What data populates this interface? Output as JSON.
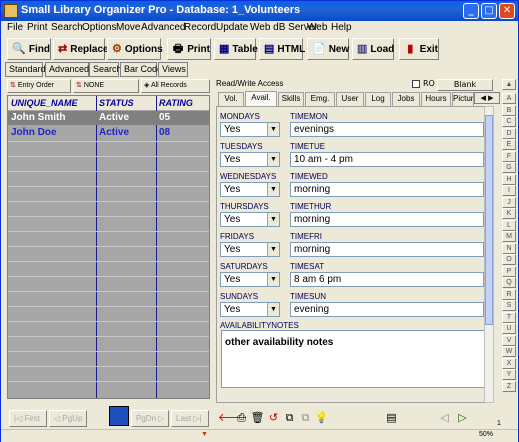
{
  "window": {
    "title": "Small Library Organizer Pro - Database: 1_Volunteers",
    "controls": [
      "_",
      "□",
      "✕"
    ]
  },
  "menu": [
    "File",
    "Print",
    "Search",
    "Options",
    "Move",
    "Advanced",
    "Record",
    "Update",
    "Web dB Server",
    "Web",
    "Help"
  ],
  "toolbar": [
    {
      "label": "Find",
      "icon": "find-icon"
    },
    {
      "label": "Replace",
      "icon": "replace-icon"
    },
    {
      "label": "Options",
      "icon": "options-icon"
    },
    {
      "label": "Print",
      "icon": "printer-icon"
    },
    {
      "label": "Table",
      "icon": "table-icon"
    },
    {
      "label": "HTML",
      "icon": "html-icon"
    },
    {
      "label": "New",
      "icon": "new-icon"
    },
    {
      "label": "Load",
      "icon": "load-icon"
    },
    {
      "label": "Exit",
      "icon": "exit-icon"
    }
  ],
  "view_tabs": [
    "Standard",
    "Advanced",
    "Search",
    "Bar Code",
    "Views"
  ],
  "sort_buttons": [
    "Entry Order",
    "NONE",
    "All Records"
  ],
  "grid": {
    "columns": [
      "UNIQUE_NAME",
      "STATUS",
      "RATING"
    ],
    "rows": [
      {
        "name": "John Smith",
        "status": "Active",
        "rating": "05",
        "selected": true
      },
      {
        "name": "John Doe",
        "status": "Active",
        "rating": "08",
        "selected": false
      }
    ]
  },
  "nav_buttons": [
    "|◁ First",
    "◁ PgUp",
    "PgDn ▷",
    "Last ▷|"
  ],
  "access": {
    "label": "Read/Write Access",
    "ro": "RO",
    "blank": "Blank"
  },
  "tabs": [
    {
      "label": "Vol.",
      "active": false
    },
    {
      "label": "Avail.",
      "active": true
    },
    {
      "label": "Skills",
      "active": false
    },
    {
      "label": "Emg.",
      "active": false
    },
    {
      "label": "User",
      "active": false
    },
    {
      "label": "Log",
      "active": false
    },
    {
      "label": "Jobs",
      "active": false
    },
    {
      "label": "Hours",
      "active": false
    },
    {
      "label": "Picture",
      "active": false
    }
  ],
  "tab_scroll": "◀ ▶",
  "days": [
    {
      "day": "MONDAYS",
      "value": "Yes",
      "time_label": "TIMEMON",
      "time": "evenings"
    },
    {
      "day": "TUESDAYS",
      "value": "Yes",
      "time_label": "TIMETUE",
      "time": "10 am  - 4 pm"
    },
    {
      "day": "WEDNESDAYS",
      "value": "Yes",
      "time_label": "TIMEWED",
      "time": "morning"
    },
    {
      "day": "THURSDAYS",
      "value": "Yes",
      "time_label": "TIMETHUR",
      "time": "morning"
    },
    {
      "day": "FRIDAYS",
      "value": "Yes",
      "time_label": "TIMEFRI",
      "time": "morning"
    },
    {
      "day": "SATURDAYS",
      "value": "Yes",
      "time_label": "TIMESAT",
      "time": "8 am  6 pm"
    },
    {
      "day": "SUNDAYS",
      "value": "Yes",
      "time_label": "TIMESUN",
      "time": "evening"
    }
  ],
  "notes": {
    "label": "AVAILABILITYNOTES",
    "value": "other availability notes"
  },
  "alphabet": [
    "A",
    "B",
    "C",
    "D",
    "E",
    "F",
    "G",
    "H",
    "I",
    "J",
    "K",
    "L",
    "M",
    "N",
    "O",
    "P",
    "Q",
    "R",
    "S",
    "T",
    "U",
    "V",
    "W",
    "X",
    "Y",
    "Z"
  ],
  "status": {
    "zoom": "50%",
    "page": "1"
  }
}
